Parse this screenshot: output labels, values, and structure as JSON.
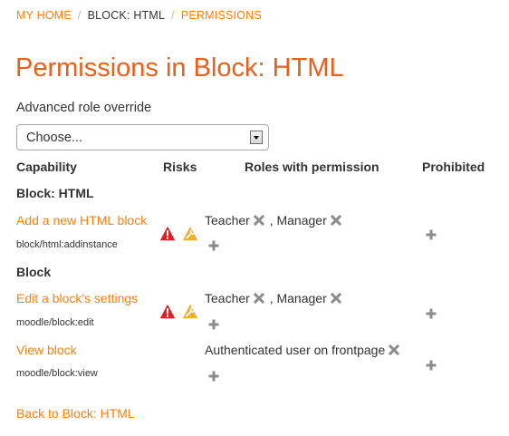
{
  "breadcrumb": {
    "home": "MY HOME",
    "block": "BLOCK: HTML",
    "permissions": "PERMISSIONS"
  },
  "page_title": "Permissions in Block: HTML",
  "role_override": {
    "label": "Advanced role override",
    "selected": "Choose..."
  },
  "table": {
    "headers": {
      "capability": "Capability",
      "risks": "Risks",
      "roles": "Roles with permission",
      "prohibited": "Prohibited"
    },
    "groups": [
      {
        "name": "Block: HTML",
        "rows": [
          {
            "capability": "Add a new HTML block",
            "code": "block/html:addinstance",
            "risks": [
              "xss-risk-icon",
              "config-risk-icon"
            ],
            "roles": [
              "Teacher",
              "Manager"
            ]
          }
        ]
      },
      {
        "name": "Block",
        "rows": [
          {
            "capability": "Edit a block's settings",
            "code": "moodle/block:edit",
            "risks": [
              "xss-risk-icon",
              "config-risk-icon"
            ],
            "roles": [
              "Teacher",
              "Manager"
            ]
          },
          {
            "capability": "View block",
            "code": "moodle/block:view",
            "risks": [],
            "roles": [
              "Authenticated user on frontpage"
            ]
          }
        ]
      }
    ],
    "role_separator": " , "
  },
  "back_link": "Back to Block: HTML",
  "colors": {
    "accent": "#f98012",
    "title": "#e4621e",
    "risk_red": "#e02020",
    "risk_yellow": "#f0b030",
    "icon_gray": "#8c8c8c"
  }
}
